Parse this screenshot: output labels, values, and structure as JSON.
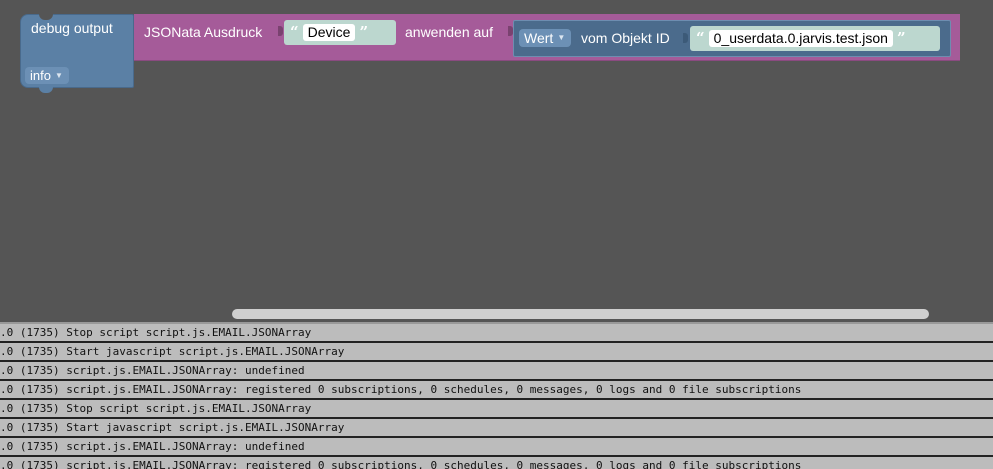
{
  "blocks": {
    "debug": {
      "title": "debug output",
      "level": "info"
    },
    "jsonata": {
      "label": "JSONata Ausdruck",
      "expression": "Device",
      "apply_label": "anwenden auf"
    },
    "object_value": {
      "type": "Wert",
      "label": "vom Objekt ID",
      "object_id": "0_userdata.0.jarvis.test.json"
    }
  },
  "log": [
    ".0 (1735) Stop script script.js.EMAIL.JSONArray",
    ".0 (1735) Start javascript script.js.EMAIL.JSONArray",
    ".0 (1735) script.js.EMAIL.JSONArray: undefined",
    ".0 (1735) script.js.EMAIL.JSONArray: registered 0 subscriptions, 0 schedules, 0 messages, 0 logs and 0 file subscriptions",
    ".0 (1735) Stop script script.js.EMAIL.JSONArray",
    ".0 (1735) Start javascript script.js.EMAIL.JSONArray",
    ".0 (1735) script.js.EMAIL.JSONArray: undefined",
    ".0 (1735) script.js.EMAIL.JSONArray: registered 0 subscriptions, 0 schedules, 0 messages, 0 logs and 0 file subscriptions"
  ]
}
